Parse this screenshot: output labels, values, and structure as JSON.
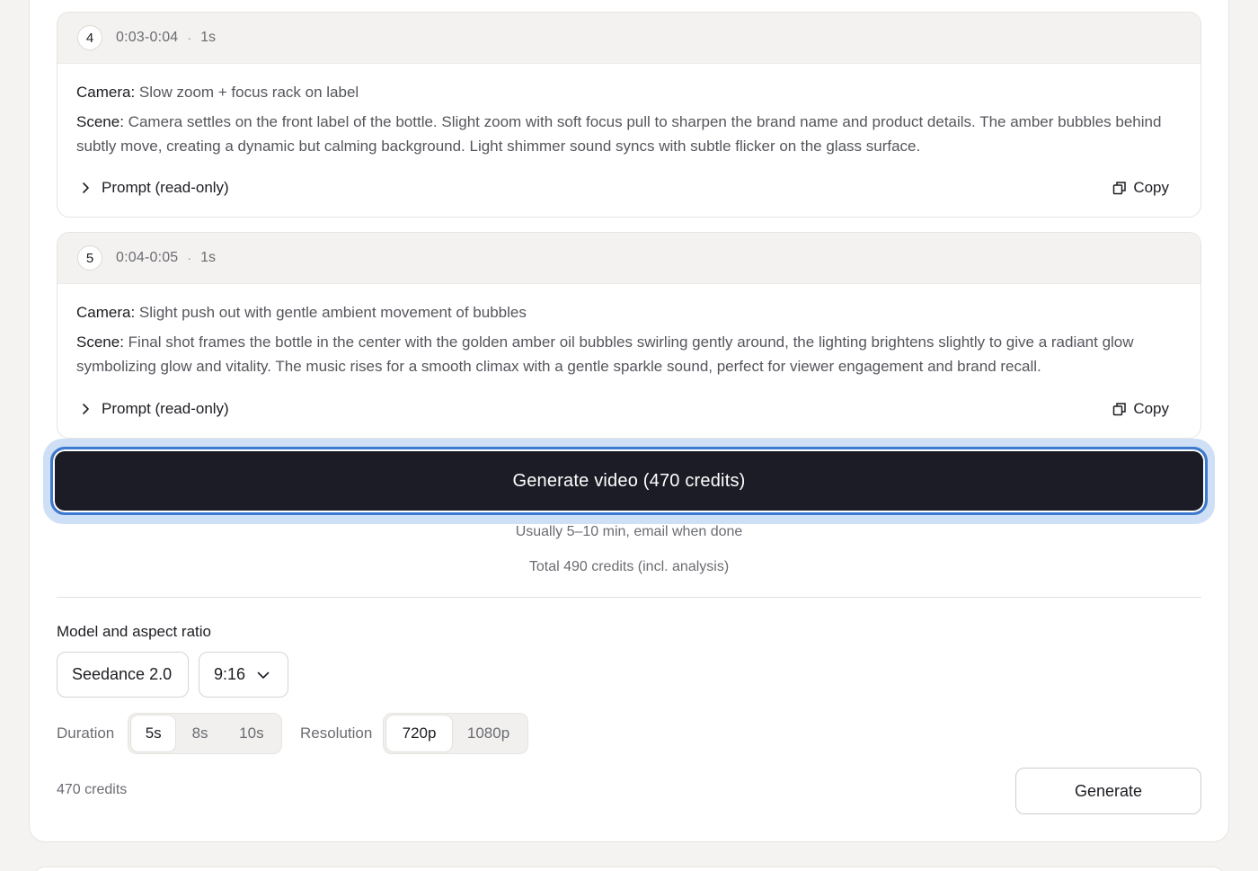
{
  "shots": [
    {
      "number": "4",
      "time_range": "0:03-0:04",
      "separator": "·",
      "duration": "1s",
      "camera_label": "Camera:",
      "camera_text": "Slow zoom + focus rack on label",
      "scene_label": "Scene:",
      "scene_text": "Camera settles on the front label of the bottle. Slight zoom with soft focus pull to sharpen the brand name and product details. The amber bubbles behind subtly move, creating a dynamic but calming background. Light shimmer sound syncs with subtle flicker on the glass surface.",
      "prompt_toggle_label": "Prompt (read-only)",
      "copy_label": "Copy"
    },
    {
      "number": "5",
      "time_range": "0:04-0:05",
      "separator": "·",
      "duration": "1s",
      "camera_label": "Camera:",
      "camera_text": "Slight push out with gentle ambient movement of bubbles",
      "scene_label": "Scene:",
      "scene_text": "Final shot frames the bottle in the center with the golden amber oil bubbles swirling gently around, the lighting brightens slightly to give a radiant glow symbolizing glow and vitality. The music rises for a smooth climax with a gentle sparkle sound, perfect for viewer engagement and brand recall.",
      "prompt_toggle_label": "Prompt (read-only)",
      "copy_label": "Copy"
    }
  ],
  "generate_video": {
    "label": "Generate video (470 credits)",
    "eta_hint": "Usually 5–10 min, email when done",
    "total_hint": "Total 490 credits (incl. analysis)"
  },
  "settings": {
    "section_title": "Model and aspect ratio",
    "model": "Seedance 2.0",
    "aspect_ratio": "9:16",
    "duration_label": "Duration",
    "duration_options": [
      "5s",
      "8s",
      "10s"
    ],
    "duration_selected": "5s",
    "resolution_label": "Resolution",
    "resolution_options": [
      "720p",
      "1080p"
    ],
    "resolution_selected": "720p",
    "credits": "470 credits",
    "generate_label": "Generate"
  },
  "icons": {
    "prompt_toggle": "chevron-right-icon",
    "copy": "copy-icon",
    "aspect_dropdown": "chevron-down-icon"
  },
  "colors": {
    "primary_button": "#1b1c25",
    "focus_ring": "#3c79d0",
    "focus_glow": "#cfe0f6",
    "page_background": "#f4f3f1"
  }
}
